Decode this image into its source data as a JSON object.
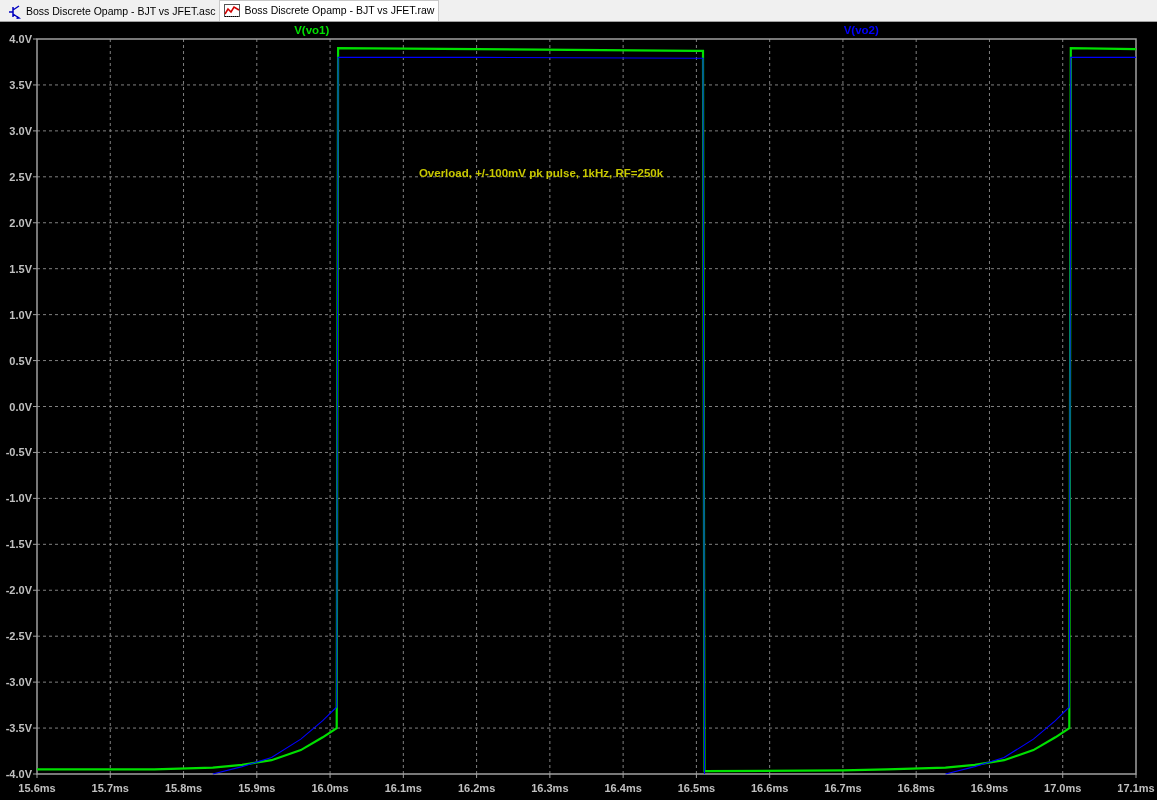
{
  "tabs": [
    {
      "label": "Boss Discrete Opamp - BJT vs JFET.asc",
      "selected": false,
      "kind": "schematic"
    },
    {
      "label": "Boss Discrete Opamp - BJT vs JFET.raw",
      "selected": true,
      "kind": "waveform"
    }
  ],
  "plot": {
    "chart_data": {
      "type": "line",
      "x": [
        15.6,
        15.76,
        15.84,
        15.88,
        15.92,
        15.96,
        15.99,
        16.009,
        16.011,
        16.2,
        16.5,
        16.509,
        16.511,
        16.7,
        16.76,
        16.84,
        16.88,
        16.92,
        16.96,
        16.99,
        17.009,
        17.011,
        17.1
      ],
      "series": [
        {
          "name": "V(vo1)",
          "color": "#00e000",
          "values": [
            -3.95,
            -3.95,
            -3.93,
            -3.9,
            -3.85,
            -3.74,
            -3.6,
            -3.5,
            3.9,
            3.89,
            3.87,
            3.87,
            -3.97,
            -3.96,
            -3.95,
            -3.93,
            -3.9,
            -3.85,
            -3.74,
            -3.6,
            -3.5,
            3.9,
            3.89
          ]
        },
        {
          "name": "V(vo2)",
          "color": "#0000ff",
          "values": [
            null,
            null,
            -4.0,
            -3.92,
            -3.82,
            -3.62,
            -3.42,
            -3.27,
            3.8,
            3.8,
            3.79,
            3.79,
            -4.0,
            null,
            null,
            -4.0,
            -3.92,
            -3.82,
            -3.62,
            -3.42,
            -3.27,
            3.8,
            3.8
          ]
        }
      ],
      "xlim": [
        15.6,
        17.1
      ],
      "ylim": [
        -4.0,
        4.0
      ],
      "xticks": [
        {
          "value": 15.6,
          "label": "15.6ms"
        },
        {
          "value": 15.7,
          "label": "15.7ms"
        },
        {
          "value": 15.8,
          "label": "15.8ms"
        },
        {
          "value": 15.9,
          "label": "15.9ms"
        },
        {
          "value": 16.0,
          "label": "16.0ms"
        },
        {
          "value": 16.1,
          "label": "16.1ms"
        },
        {
          "value": 16.2,
          "label": "16.2ms"
        },
        {
          "value": 16.3,
          "label": "16.3ms"
        },
        {
          "value": 16.4,
          "label": "16.4ms"
        },
        {
          "value": 16.5,
          "label": "16.5ms"
        },
        {
          "value": 16.6,
          "label": "16.6ms"
        },
        {
          "value": 16.7,
          "label": "16.7ms"
        },
        {
          "value": 16.8,
          "label": "16.8ms"
        },
        {
          "value": 16.9,
          "label": "16.9ms"
        },
        {
          "value": 17.0,
          "label": "17.0ms"
        },
        {
          "value": 17.1,
          "label": "17.1ms"
        }
      ],
      "yticks": [
        {
          "value": 4.0,
          "label": "4.0V"
        },
        {
          "value": 3.5,
          "label": "3.5V"
        },
        {
          "value": 3.0,
          "label": "3.0V"
        },
        {
          "value": 2.5,
          "label": "2.5V"
        },
        {
          "value": 2.0,
          "label": "2.0V"
        },
        {
          "value": 1.5,
          "label": "1.5V"
        },
        {
          "value": 1.0,
          "label": "1.0V"
        },
        {
          "value": 0.5,
          "label": "0.5V"
        },
        {
          "value": 0.0,
          "label": "0.0V"
        },
        {
          "value": -0.5,
          "label": "-0.5V"
        },
        {
          "value": -1.0,
          "label": "-1.0V"
        },
        {
          "value": -1.5,
          "label": "-1.5V"
        },
        {
          "value": -2.0,
          "label": "-2.0V"
        },
        {
          "value": -2.5,
          "label": "-2.5V"
        },
        {
          "value": -3.0,
          "label": "-3.0V"
        },
        {
          "value": -3.5,
          "label": "-3.5V"
        },
        {
          "value": -4.0,
          "label": "-4.0V"
        }
      ],
      "grid": true,
      "annotations": [
        "Overload, +/-100mV pk pulse, 1kHz, RF=250k"
      ]
    }
  }
}
